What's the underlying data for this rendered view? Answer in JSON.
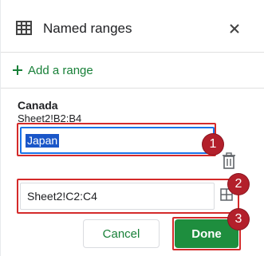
{
  "header": {
    "title": "Named ranges",
    "icon": "table-icon",
    "close_icon": "close-icon"
  },
  "actions": {
    "add_range_label": "Add a range"
  },
  "existing_range": {
    "name": "Canada",
    "reference": "Sheet2!B2:B4"
  },
  "edit_form": {
    "name_value": "Japan",
    "range_value": "Sheet2!C2:C4",
    "cancel_label": "Cancel",
    "done_label": "Done"
  },
  "callouts": [
    "1",
    "2",
    "3"
  ],
  "colors": {
    "accent_green": "#188038",
    "done_button": "#1e8e3e",
    "focus_blue": "#1a73e8",
    "callout_red": "#b3202b"
  }
}
